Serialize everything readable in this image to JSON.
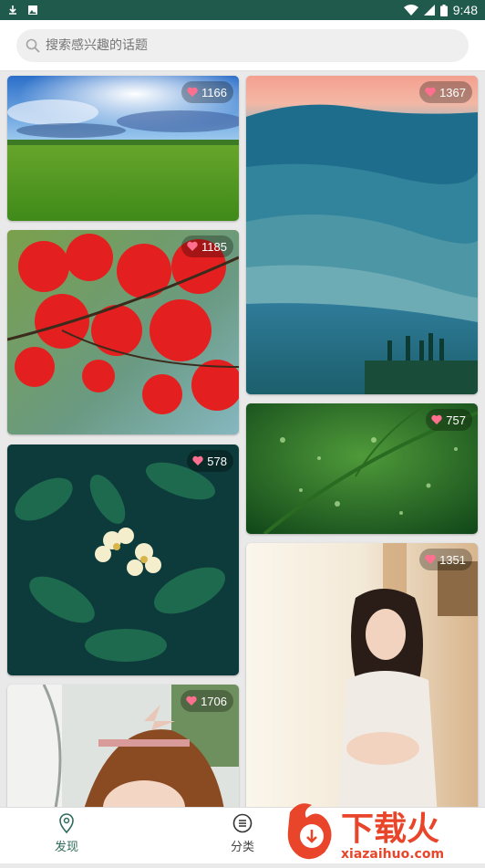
{
  "status_bar": {
    "time": "9:48",
    "icons": [
      "download-icon",
      "image-icon",
      "wifi-icon",
      "signal-icon",
      "battery-icon"
    ]
  },
  "search": {
    "placeholder": "搜索感兴趣的话题"
  },
  "feed": {
    "cards": [
      {
        "name": "card-meadow",
        "likes": "1166",
        "scene": "meadow"
      },
      {
        "name": "card-mountains",
        "likes": "1367",
        "scene": "mountains"
      },
      {
        "name": "card-maple",
        "likes": "1185",
        "scene": "maple"
      },
      {
        "name": "card-leaf",
        "likes": "757",
        "scene": "leaf"
      },
      {
        "name": "card-flower",
        "likes": "578",
        "scene": "flower"
      },
      {
        "name": "card-woman",
        "likes": "1351",
        "scene": "woman"
      },
      {
        "name": "card-girl",
        "likes": "1706",
        "scene": "girl"
      }
    ]
  },
  "nav": {
    "discover_label": "发现",
    "category_label": "分类"
  },
  "watermark": {
    "text": "下载火",
    "url_text": "xiazaihuo.com"
  },
  "colors": {
    "status_bar": "#1f5a4c",
    "accent": "#2f6b5a",
    "heart": "#ff6f8f",
    "watermark": "#e8452a"
  }
}
